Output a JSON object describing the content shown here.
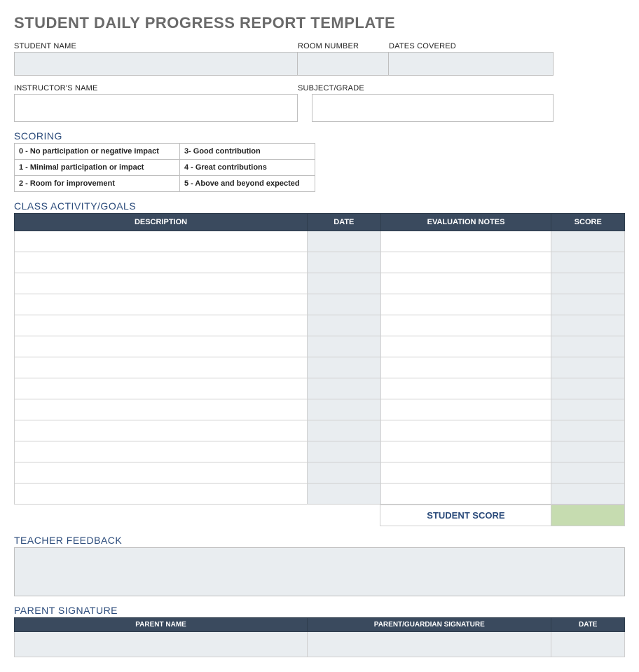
{
  "title": "STUDENT DAILY PROGRESS REPORT TEMPLATE",
  "fields": {
    "student_name_label": "STUDENT NAME",
    "room_number_label": "ROOM NUMBER",
    "dates_covered_label": "DATES COVERED",
    "instructor_label": "INSTRUCTOR'S NAME",
    "subject_label": "SUBJECT/GRADE"
  },
  "scoring": {
    "heading": "SCORING",
    "rows": [
      {
        "left": "0 - No participation or negative impact",
        "right": "3- Good contribution"
      },
      {
        "left": "1 - Minimal participation or impact",
        "right": "4 - Great contributions"
      },
      {
        "left": "2 - Room for improvement",
        "right": "5 - Above and beyond expected"
      }
    ]
  },
  "activity": {
    "heading": "CLASS ACTIVITY/GOALS",
    "headers": {
      "description": "DESCRIPTION",
      "date": "DATE",
      "evaluation": "EVALUATION NOTES",
      "score": "SCORE"
    },
    "row_count": 13,
    "student_score_label": "STUDENT SCORE"
  },
  "feedback": {
    "heading": "TEACHER FEEDBACK"
  },
  "signature": {
    "heading": "PARENT SIGNATURE",
    "headers": {
      "name": "PARENT NAME",
      "sig": "PARENT/GUARDIAN SIGNATURE",
      "date": "DATE"
    }
  }
}
